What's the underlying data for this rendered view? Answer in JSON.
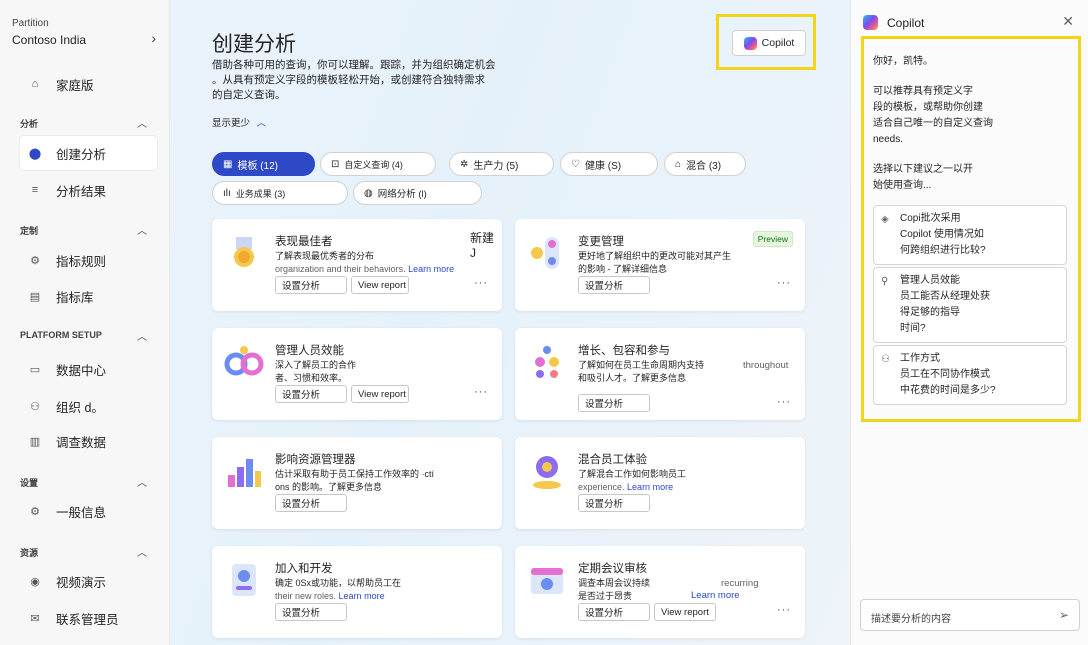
{
  "sidebar": {
    "partition_label": "Partition",
    "partition_value": "Contoso India",
    "home": "家庭版",
    "sections": {
      "analysis": "分析",
      "custom": "定制",
      "platform": "PLATFORM SETUP",
      "settings": "设置",
      "resources": "资源"
    },
    "items": {
      "create": "创建分析",
      "results": "分析结果",
      "rules": "指标规则",
      "library": "指标库",
      "datacenter": "数据中心",
      "org": "组织 d。",
      "survey": "调查数据",
      "general": "一般信息",
      "video": "视频演示",
      "contact": "联系管理员"
    }
  },
  "main": {
    "title": "创建分析",
    "desc1": "借助各种可用的查询，你可以理解。跟踪，并为组织确定机会",
    "desc2": "。从具有预定义字段的模板轻松开始，或创建符合独特需求",
    "desc3": "的自定义查询。",
    "show_less": "显示更少",
    "copilot_label": "Copilot",
    "chips": {
      "templates": "模板 (12)",
      "custom": "自定义查询 (4)",
      "productivity": "生产力 (5)",
      "health": "健康 (S)",
      "mixed": "混合 (3)",
      "business": "业务成果 (3)",
      "network": "网络分析 (l)"
    },
    "cards": {
      "c1": {
        "title": "表现最佳者",
        "d1": "了解表现最优秀者的分布",
        "d2": "organization and their behaviors.",
        "link": "Learn more",
        "extra": "新建 J"
      },
      "c2": {
        "title": "变更管理",
        "d1": "更好地了解组织中的更改可能对其产生",
        "d2": "的影响 - 了解详细信息",
        "badge": "Preview"
      },
      "c3": {
        "title": "管理人员效能",
        "d1": "深入了解员工的合作",
        "d2": "者、习惯和效率。"
      },
      "c4": {
        "title": "增长、包容和参与",
        "d1": "了解如何在员工生命周期内支持",
        "d2": "和吸引人才。了解更多信息",
        "extra": "throughout"
      },
      "c5": {
        "title": "影响资源管理器",
        "d1": "估计采取有助于员工保持工作效率的 ·ctí",
        "d2": "ons 的影响。了解更多信息"
      },
      "c6": {
        "title": "混合员工体验",
        "d1": "了解混合工作如何影响员工",
        "d2": "experience.",
        "link": "Learn more"
      },
      "c7": {
        "title": "加入和开发",
        "d1": "确定 0Sx或功能，以帮助员工在",
        "d2": "their new roles.",
        "link": "Learn more"
      },
      "c8": {
        "title": "定期会议审核",
        "d1": "调查本周会议持续",
        "d2": "是否过于昂贵",
        "link": "Learn more",
        "extra": "recurring"
      },
      "setup": "设置分析",
      "view": "View report",
      "more": "···"
    }
  },
  "panel": {
    "title": "Copilot",
    "greet": "你好，凯特。",
    "m1": "可以推荐具有预定义字",
    "m2": "段的模板，或帮助你创建",
    "m3": "适合自己唯一的自定义查询",
    "m4": "needs.",
    "m5": "选择以下建议之一以开",
    "m6": "始使用查询...",
    "s1a": "Copi批次采用",
    "s1b": "Copilot 使用情况如",
    "s1c": "何跨组织进行比较?",
    "s2a": "管理人员效能",
    "s2b": "员工能否从经理处获",
    "s2c": "得足够的指导",
    "s2d": "时间?",
    "s3a": "工作方式",
    "s3b": "员工在不同协作模式",
    "s3c": "中花费的时间是多少?",
    "input_placeholder": "描述要分析的内容"
  },
  "colors": {
    "accent": "#2e49c7",
    "highlight": "#f2d418",
    "preview_green": "#107c10"
  }
}
